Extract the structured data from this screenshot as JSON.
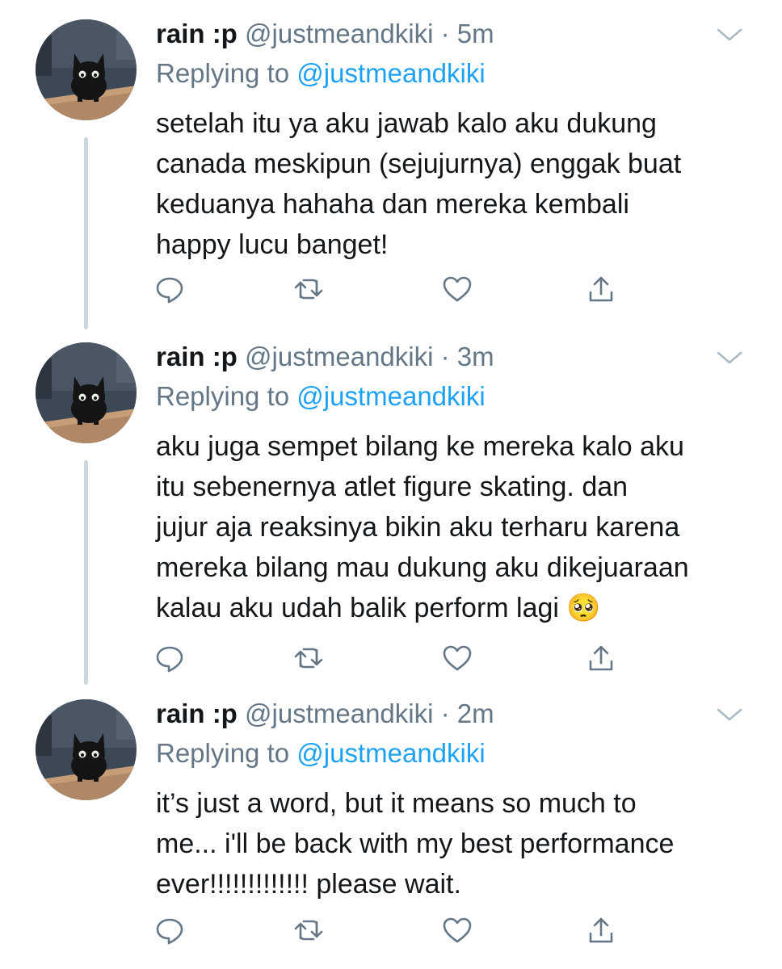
{
  "colors": {
    "text": "#14171a",
    "secondary": "#657786",
    "link": "#1da1f2",
    "thread_line": "#ccd6dd",
    "icon": "#657786"
  },
  "icons": [
    "reply-icon",
    "retweet-icon",
    "like-icon",
    "share-icon",
    "caret-down-icon",
    "pleading-face-emoji"
  ],
  "tweets": [
    {
      "name": "rain :p",
      "handle": "@justmeandkiki",
      "separator": "·",
      "time": "5m",
      "replying_prefix": "Replying to",
      "replying_handle": "@justmeandkiki",
      "lines": [
        "setelah itu ya aku jawab kalo aku dukung",
        "canada meskipun (sejujurnya) enggak buat",
        "keduanya hahaha dan mereka kembali",
        "happy lucu banget!"
      ]
    },
    {
      "name": "rain :p",
      "handle": "@justmeandkiki",
      "separator": "·",
      "time": "3m",
      "replying_prefix": "Replying to",
      "replying_handle": "@justmeandkiki",
      "lines": [
        "aku juga sempet bilang ke mereka kalo aku",
        "itu sebenernya atlet figure skating. dan",
        "jujur aja reaksinya bikin aku terharu karena",
        "mereka bilang mau dukung aku dikejuaraan",
        "kalau aku udah balik perform lagi"
      ],
      "emoji": "🥺"
    },
    {
      "name": "rain :p",
      "handle": "@justmeandkiki",
      "separator": "·",
      "time": "2m",
      "replying_prefix": "Replying to",
      "replying_handle": "@justmeandkiki",
      "lines": [
        "it’s just a word, but it means so much to",
        "me... i'll be back with my best performance",
        "ever!!!!!!!!!!!!! please wait."
      ]
    }
  ]
}
